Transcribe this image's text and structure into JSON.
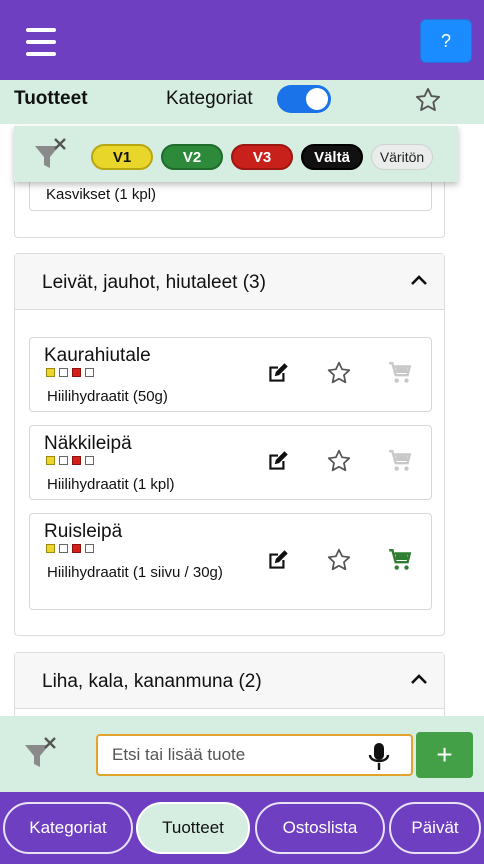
{
  "appbar": {
    "help_label": "?"
  },
  "header": {
    "title": "Tuotteet",
    "categories_label": "Kategoriat",
    "categories_toggle_on": true
  },
  "filters": {
    "chips": [
      {
        "label": "V1",
        "color": "#e9d62a"
      },
      {
        "label": "V2",
        "color": "#2d8a3b"
      },
      {
        "label": "V3",
        "color": "#c8211b"
      },
      {
        "label": "Vältä",
        "color": "#111111"
      },
      {
        "label": "Väritön",
        "color": "#e9ecea"
      }
    ]
  },
  "groups": [
    {
      "partial_item_sub": "Kasvikset (1 kpl)"
    },
    {
      "title": "Leivät, jauhot, hiutaleet (3)",
      "items": [
        {
          "name": "Kaurahiutale",
          "sub": "Hiilihydraatit (50g)",
          "in_cart": false
        },
        {
          "name": "Näkkileipä",
          "sub": "Hiilihydraatit (1 kpl)",
          "in_cart": false
        },
        {
          "name": "Ruisleipä",
          "sub": "Hiilihydraatit (1 siivu / 30g)",
          "in_cart": true
        }
      ]
    },
    {
      "title": "Liha, kala, kananmuna (2)"
    }
  ],
  "search": {
    "placeholder": "Etsi tai lisää tuote",
    "add_label": "+"
  },
  "nav": {
    "items": [
      {
        "label": "Kategoriat",
        "active": false
      },
      {
        "label": "Tuotteet",
        "active": true
      },
      {
        "label": "Ostoslista",
        "active": false
      },
      {
        "label": "Päivät",
        "active": false
      }
    ]
  },
  "colors": {
    "primary": "#6f3fc2",
    "accent_bg": "#d6eee2",
    "cart_active": "#2e7d32",
    "cart_inactive": "#c8c8c8"
  }
}
